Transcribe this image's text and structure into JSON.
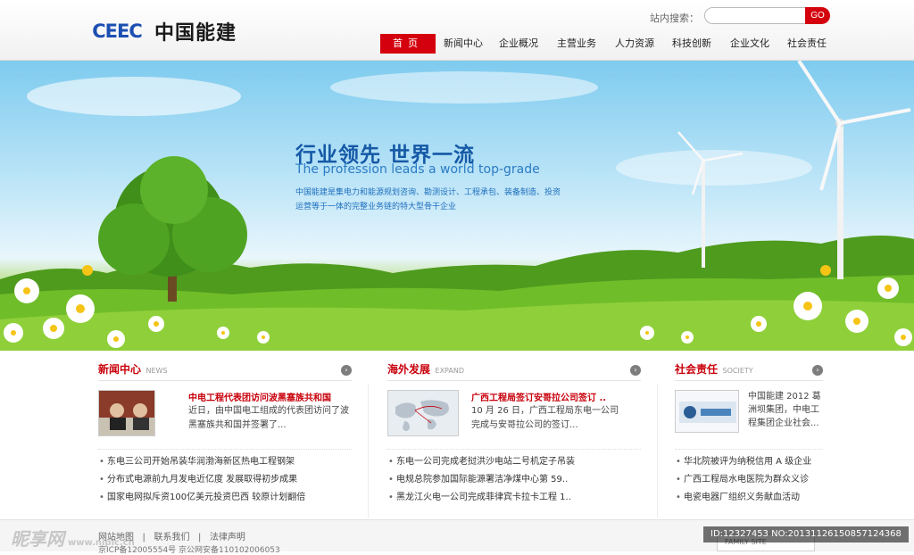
{
  "header": {
    "logo_mark": "CEEC",
    "logo_text": "中国能建",
    "search_label": "站内搜索：",
    "search_value": "",
    "search_button": "GO"
  },
  "nav": [
    "首页",
    "新闻中心",
    "企业概况",
    "主营业务",
    "人力资源",
    "科技创新",
    "企业文化",
    "社会责任"
  ],
  "banner": {
    "title": "行业领先  世界一流",
    "subtitle": "The profession leads a world top-grade",
    "desc": "中国能建是集电力和能源规划咨询、勘测设计、工程承包、装备制造、投资运营等于一体的完整业务链的特大型骨干企业"
  },
  "columns": [
    {
      "title": "新闻中心",
      "sub": "NEWS",
      "feature_title": "中电工程代表团访问波黑塞族共和国",
      "feature_text": "近日，由中国电工组成的代表团访问了波黑塞族共和国并签署了...",
      "items": [
        "东电三公司开始吊装华润渤海新区热电工程钢架",
        "分布式电源前九月发电近亿度 发展取得初步成果",
        "国家电网拟斥资100亿美元投资巴西 较原计划翻倍"
      ]
    },
    {
      "title": "海外发展",
      "sub": "EXPAND",
      "feature_title": "广西工程局签订安哥拉公司签订 ..",
      "feature_text": "10 月 26 日，广西工程局东电一公司完成与安哥拉公司的签订...",
      "items": [
        "东电一公司完成老挝洪沙电站二号机定子吊装",
        "电规总院参加国际能源署洁净煤中心第 59..",
        "黑龙江火电一公司完成菲律宾卡拉卡工程 1.."
      ]
    },
    {
      "title": "社会责任",
      "sub": "SOCIETY",
      "feature_title": "",
      "feature_text": "中国能建 2012 葛洲坝集团，中电工程集团企业社会...",
      "items": [
        "华北院被评为纳税信用 A 级企业",
        "广西工程局水电医院为群众义诊",
        "电瓷电器厂组织义务献血活动"
      ]
    }
  ],
  "footer": {
    "links": [
      "网站地图",
      "联系我们",
      "法律声明"
    ],
    "icp": "京ICP备12005554号  京公网安备110102006053",
    "family_site": "FAMILY SITE"
  },
  "watermark": {
    "brand": "昵享网",
    "url": "www.nipic.cn"
  },
  "image_id": "ID:12327453 NO:20131126150857124368"
}
